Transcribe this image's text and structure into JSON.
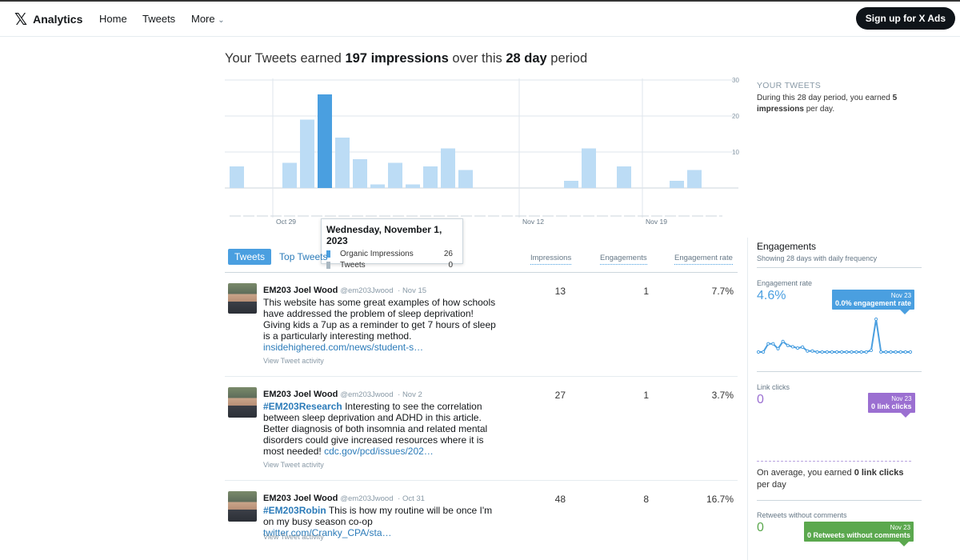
{
  "header": {
    "logo_glyph": "𝕏",
    "logo_text": "Analytics",
    "nav": [
      "Home",
      "Tweets",
      "More"
    ],
    "more_chevron": "⌄",
    "signup_label": "Sign up for X Ads"
  },
  "summary": {
    "prefix": "Your Tweets earned",
    "impressions": "197 impressions",
    "middle": "over this",
    "period": "28 day",
    "suffix": "period"
  },
  "chart_data": {
    "type": "bar",
    "title": "",
    "xlabel": "",
    "ylabel": "",
    "ylim": [
      0,
      30
    ],
    "yticks": [
      10,
      20,
      30
    ],
    "x_tick_labels": [
      {
        "index": 2,
        "label": "Oct 29"
      },
      {
        "index": 16,
        "label": "Nov 12"
      },
      {
        "index": 23,
        "label": "Nov 19"
      }
    ],
    "highlight_index": 5,
    "colors": {
      "bar": "#bcdcf5",
      "highlight": "#4a9fe0",
      "grid": "#dfe6ec"
    },
    "values": [
      6,
      0,
      0,
      7,
      19,
      26,
      14,
      8,
      1,
      7,
      1,
      6,
      11,
      5,
      0,
      0,
      0,
      0,
      0,
      2,
      11,
      0,
      6,
      0,
      0,
      2,
      5,
      0
    ]
  },
  "tooltip": {
    "date": "Wednesday, November 1, 2023",
    "rows": [
      {
        "label": "Organic Impressions",
        "value": "26",
        "color": "#4a9fe0"
      },
      {
        "label": "Tweets",
        "value": "0",
        "color": "#aab8c2"
      }
    ]
  },
  "tabs": {
    "active": "Tweets",
    "other": "Top Tweets"
  },
  "columns": {
    "impressions": "Impressions",
    "engagements": "Engagements",
    "rate": "Engagement rate"
  },
  "tweets": [
    {
      "name": "EM203 Joel Wood",
      "handle": "@em203Jwood",
      "date": "Nov 15",
      "hashtag": "",
      "text": "This website has some great examples of how schools have addressed the problem of sleep deprivation! Giving kids a 7up as a reminder to get 7 hours of sleep is a particularly interesting method.",
      "link": "insidehighered.com/news/student-s…",
      "activity": "View Tweet activity",
      "impressions": "13",
      "engagements": "1",
      "rate": "7.7%"
    },
    {
      "name": "EM203 Joel Wood",
      "handle": "@em203Jwood",
      "date": "Nov 2",
      "hashtag": "#EM203Research",
      "text": "Interesting to see the correlation between sleep deprivation and ADHD in this article. Better diagnosis of both insomnia and related mental disorders could give increased resources where it is most needed!",
      "link": "cdc.gov/pcd/issues/202…",
      "activity": "View Tweet activity",
      "impressions": "27",
      "engagements": "1",
      "rate": "3.7%"
    },
    {
      "name": "EM203 Joel Wood",
      "handle": "@em203Jwood",
      "date": "Oct 31",
      "hashtag": "#EM203Robin",
      "text": "This is how my routine will be once I'm on my busy season co-op",
      "link": "twitter.com/Cranky_CPA/sta…",
      "activity": "View Tweet activity",
      "impressions": "48",
      "engagements": "8",
      "rate": "16.7%"
    }
  ],
  "your_tweets": {
    "title": "YOUR TWEETS",
    "text_prefix": "During this 28 day period, you earned",
    "bold": "5 impressions",
    "text_suffix": "per day."
  },
  "engagements": {
    "title": "Engagements",
    "subtitle": "Showing 28 days with daily frequency",
    "rate": {
      "label": "Engagement rate",
      "value": "4.6%",
      "badge_date": "Nov 23",
      "badge_text": "0.0% engagement rate",
      "color": "#4a9fe0",
      "spark": [
        0,
        0,
        2.5,
        2.5,
        1,
        3.2,
        2,
        1.6,
        1.2,
        1.5,
        0.3,
        0.3,
        0,
        0,
        0,
        0,
        0,
        0,
        0,
        0,
        0,
        0,
        0,
        0.5,
        10,
        0,
        0,
        0,
        0,
        0,
        0,
        0
      ]
    },
    "links": {
      "label": "Link clicks",
      "value": "0",
      "badge_date": "Nov 23",
      "badge_text": "0 link clicks",
      "color": "#9b6fd1",
      "avg_prefix": "On average, you earned",
      "avg_bold": "0 link clicks",
      "avg_suffix": "per day"
    },
    "retweets": {
      "label": "Retweets without comments",
      "value": "0",
      "badge_date": "Nov 23",
      "badge_text": "0 Retweets without comments",
      "color": "#5ba84e"
    }
  }
}
